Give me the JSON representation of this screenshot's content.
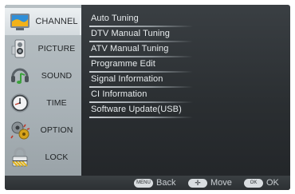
{
  "sidebar": {
    "items": [
      {
        "label": "CHANNEL",
        "icon": "channel-icon",
        "active": true
      },
      {
        "label": "PICTURE",
        "icon": "picture-icon"
      },
      {
        "label": "SOUND",
        "icon": "sound-icon"
      },
      {
        "label": "TIME",
        "icon": "time-icon"
      },
      {
        "label": "OPTION",
        "icon": "option-icon"
      },
      {
        "label": "LOCK",
        "icon": "lock-icon"
      }
    ]
  },
  "menu": {
    "items": [
      {
        "label": "Auto Tuning"
      },
      {
        "label": "DTV Manual Tuning"
      },
      {
        "label": "ATV Manual Tuning"
      },
      {
        "label": "Programme Edit"
      },
      {
        "label": "Signal Information"
      },
      {
        "label": "CI Information"
      },
      {
        "label": "Software Update(USB)"
      }
    ]
  },
  "bottom": {
    "back": {
      "key": "MENU",
      "label": "Back"
    },
    "move": {
      "key": "✛",
      "label": "Move"
    },
    "ok": {
      "key": "OK",
      "label": "OK"
    }
  },
  "colors": {
    "frame": "#2f3336",
    "sidebar": "#b0b8bc",
    "text": "#e8ecee"
  }
}
